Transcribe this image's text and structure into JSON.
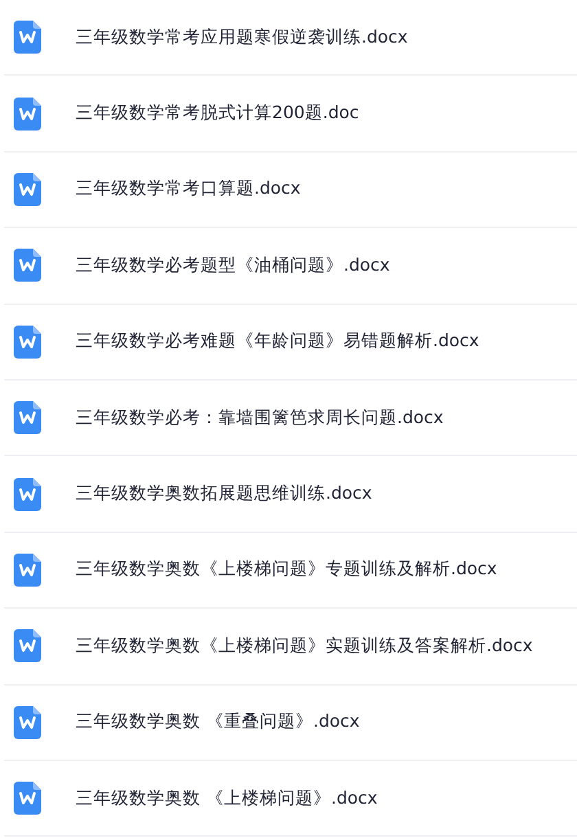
{
  "files": [
    {
      "name": "三年级数学常考应用题寒假逆袭训练.docx"
    },
    {
      "name": "三年级数学常考脱式计算200题.doc"
    },
    {
      "name": "三年级数学常考口算题.docx"
    },
    {
      "name": "三年级数学必考题型《油桶问题》.docx"
    },
    {
      "name": "三年级数学必考难题《年龄问题》易错题解析.docx"
    },
    {
      "name": "三年级数学必考：靠墙围篱笆求周长问题.docx"
    },
    {
      "name": "三年级数学奥数拓展题思维训练.docx"
    },
    {
      "name": "三年级数学奥数《上楼梯问题》专题训练及解析.docx"
    },
    {
      "name": "三年级数学奥数《上楼梯问题》实题训练及答案解析.docx"
    },
    {
      "name": "三年级数学奥数 《重叠问题》.docx"
    },
    {
      "name": "三年级数学奥数 《上楼梯问题》.docx"
    }
  ]
}
